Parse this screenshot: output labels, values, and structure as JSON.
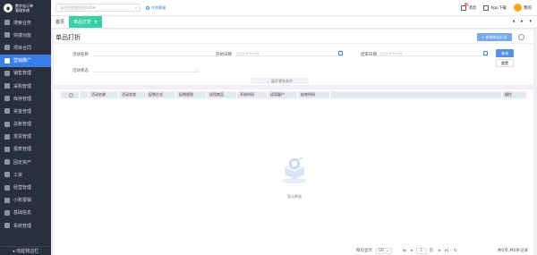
{
  "brand": {
    "logo_text": "数字化订单\n管理系统"
  },
  "sidebar": {
    "items": [
      {
        "label": "搜索业务",
        "icon": "search-icon"
      },
      {
        "label": "快捷功能",
        "icon": "lightning-icon"
      },
      {
        "label": "项目合同",
        "icon": "contract-icon"
      },
      {
        "label": "营销推广",
        "icon": "megaphone-icon",
        "active": true
      },
      {
        "label": "销售管理",
        "icon": "chart-icon"
      },
      {
        "label": "采购管理",
        "icon": "cart-icon"
      },
      {
        "label": "库存管理",
        "icon": "box-icon"
      },
      {
        "label": "资金管理",
        "icon": "wallet-icon"
      },
      {
        "label": "总账管理",
        "icon": "ledger-icon"
      },
      {
        "label": "发票管理",
        "icon": "invoice-icon"
      },
      {
        "label": "报表管理",
        "icon": "report-icon"
      },
      {
        "label": "固定资产",
        "icon": "asset-icon"
      },
      {
        "label": "工资",
        "icon": "salary-icon"
      },
      {
        "label": "经营管理",
        "icon": "business-icon"
      },
      {
        "label": "小账报销",
        "icon": "reimburse-icon"
      },
      {
        "label": "基础信息",
        "icon": "info-icon"
      },
      {
        "label": "系统管理",
        "icon": "gear-icon"
      }
    ],
    "collapse_label": "收起侧边栏"
  },
  "topbar": {
    "search_placeholder": "请选择需要搜索的菜单",
    "online_label": "在线客服",
    "message_label": "消息",
    "message_count": "1",
    "app_label": "App下载",
    "user_name": "我的"
  },
  "tabs": [
    {
      "label": "首页"
    },
    {
      "label": "单品打折",
      "active": true
    }
  ],
  "page": {
    "title": "单品打折",
    "create_button": "+ 新增单品打折",
    "filters": {
      "activity_name_label": "活动名称",
      "activity_name_placeholder": "",
      "start_date_label": "开始日期",
      "start_date_placeholder": "yyyy-mm-dd",
      "end_date_label": "结束日期",
      "end_date_placeholder": "yyyy-mm-dd",
      "activity_status_label": "活动状态",
      "activity_status_placeholder": ""
    },
    "query_button": "查询",
    "reset_button": "重置",
    "expand_label": "展开更多条件",
    "table": {
      "columns": [
        "活动名称",
        "活动状态",
        "促销方式",
        "促销规则",
        "适用商品",
        "开始时间",
        "适用客户",
        "结束时间",
        "操作"
      ]
    },
    "empty_text": "暂无数据",
    "pagination": {
      "page_size_label": "每页显示",
      "page_size": "50",
      "current_page": "1",
      "total_pages_label": "页",
      "total_label": "共0页,共0条记录"
    }
  },
  "colors": {
    "accent": "#3a7fe8",
    "sidebar_bg": "#2a2f3e",
    "tab_active": "#3acfa7"
  }
}
